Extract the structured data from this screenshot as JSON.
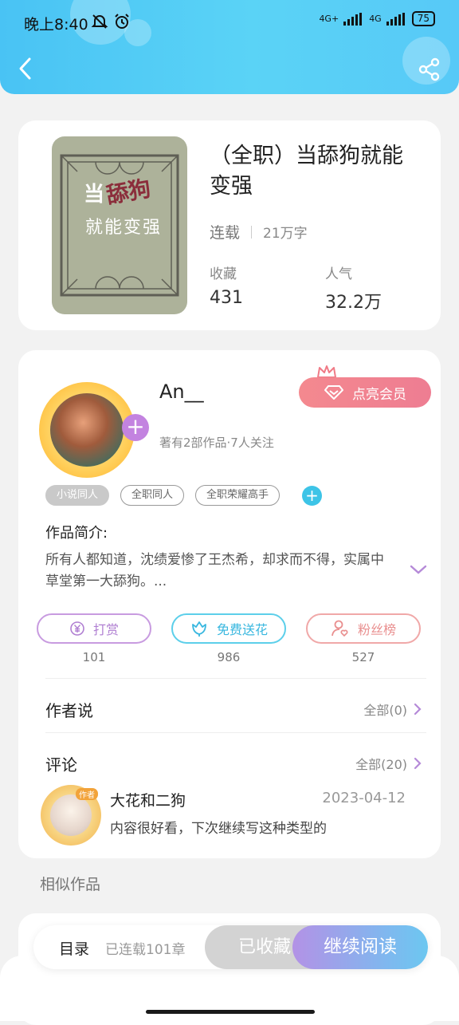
{
  "status_bar": {
    "time": "晚上8:40",
    "network1": "4G+",
    "network2": "4G",
    "battery": "75"
  },
  "book": {
    "cover_title_line1_a": "当",
    "cover_title_line1_b": "舔狗",
    "cover_title_line2": "就能变强",
    "title": "（全职）当舔狗就能变强",
    "status": "连载",
    "word_count": "21万字",
    "favorites_label": "收藏",
    "favorites_value": "431",
    "popularity_label": "人气",
    "popularity_value": "32.2万"
  },
  "author": {
    "name": "An__",
    "stats": "著有2部作品·7人关注",
    "vip_label": "点亮会员",
    "tags": [
      "小说同人",
      "全职同人",
      "全职荣耀高手"
    ],
    "intro_label": "作品简介:",
    "intro_text": "所有人都知道，沈绩爱惨了王杰希，却求而不得，实属中草堂第一大舔狗。..."
  },
  "actions": [
    {
      "label": "打赏",
      "count": "101",
      "icon": "yen-coin-icon"
    },
    {
      "label": "免费送花",
      "count": "986",
      "icon": "flower-icon"
    },
    {
      "label": "粉丝榜",
      "count": "527",
      "icon": "fan-user-icon"
    }
  ],
  "author_says": {
    "title": "作者说",
    "more": "全部(0)"
  },
  "comments": {
    "title": "评论",
    "more": "全部(20)",
    "items": [
      {
        "badge": "作者",
        "user": "大花和二狗",
        "date": "2023-04-12",
        "text": "内容很好看，下次继续写这种类型的"
      }
    ]
  },
  "similar": {
    "title": "相似作品"
  },
  "bottom_bar": {
    "toc_label": "目录",
    "toc_sub": "已连载101章",
    "collect_label": "已收藏",
    "read_label": "继续阅读"
  },
  "colors": {
    "header": "#49c3f4",
    "vip": "#ee7d92",
    "accent_purple": "#c383e0",
    "accent_cyan": "#3dc4e7"
  }
}
